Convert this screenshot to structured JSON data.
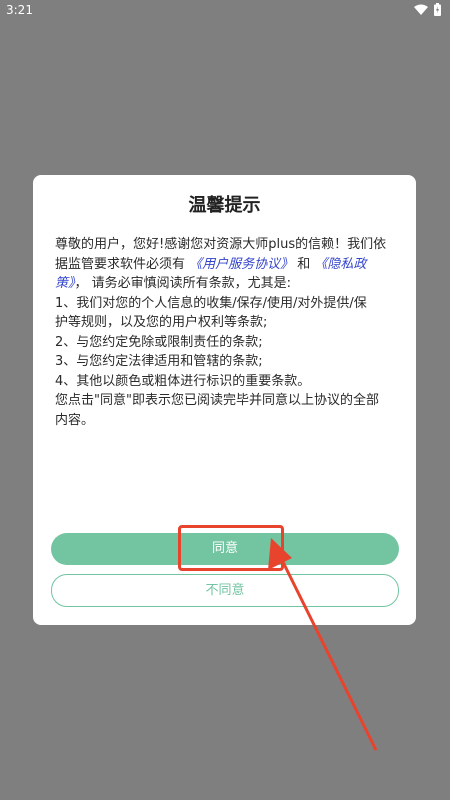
{
  "status_bar": {
    "time": "3:21",
    "battery_icon": "battery-icon",
    "wifi_icon": "wifi-icon"
  },
  "dialog": {
    "title": "温馨提示",
    "body": {
      "l1": "尊敬的用户，您好!感谢您对资源大师plus的信赖！我们依",
      "l2_pre": "据监管要求软件必须有 ",
      "link_user": "《用户服务协议》",
      "l2_and": " 和 ",
      "link_privacy_a": "《隐私政",
      "link_privacy_b": "策》",
      "l3_post": "， 请务必审慎阅读所有条款，尤其是:",
      "l4": "1、我们对您的个人信息的收集/保存/使用/对外提供/保",
      "l5": "护等规则，以及您的用户权利等条款;",
      "l6": "2、与您约定免除或限制责任的条款;",
      "l7": "3、与您约定法律适用和管辖的条款;",
      "l8": "4、其他以颜色或粗体进行标识的重要条款。",
      "l9": "您点击\"同意\"即表示您已阅读完毕并同意以上协议的全部",
      "l10": "内容。"
    },
    "agree_label": "同意",
    "disagree_label": "不同意"
  },
  "colors": {
    "accent": "#73c4a0",
    "link": "#3344cc",
    "annotation": "#e8432d",
    "overlay": "#7f7f7f"
  }
}
